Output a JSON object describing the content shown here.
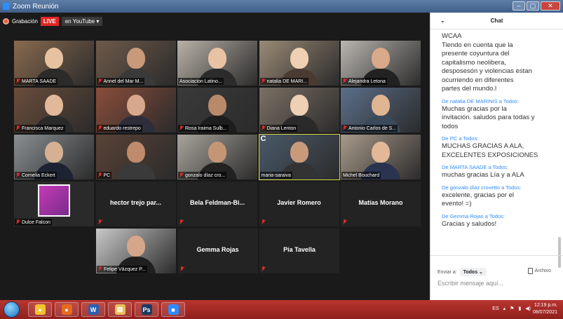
{
  "window": {
    "title": "Zoom Reunión"
  },
  "toolbar": {
    "recording_label": "Grabación",
    "live_label": "LIVE",
    "stream_target": "en YouTube"
  },
  "participants": [
    {
      "name": "MARTA SAADE",
      "muted": true,
      "video": true
    },
    {
      "name": "Annel del Mar M...",
      "muted": true,
      "video": true
    },
    {
      "name": "Asociacion Latino...",
      "muted": false,
      "video": true
    },
    {
      "name": "natalia DE MARI...",
      "muted": true,
      "video": true
    },
    {
      "name": "Alejandra Letona",
      "muted": true,
      "video": true
    },
    {
      "name": "Francisca Marquez",
      "muted": true,
      "video": true
    },
    {
      "name": "eduardo restrepo",
      "muted": true,
      "video": true
    },
    {
      "name": "Rosa Iraima Sulb...",
      "muted": true,
      "video": true
    },
    {
      "name": "Diana Lenton",
      "muted": true,
      "video": true
    },
    {
      "name": "Antonio Carlos de S...",
      "muted": true,
      "video": true
    },
    {
      "name": "Cornelia Eckert",
      "muted": true,
      "video": true
    },
    {
      "name": "PC",
      "muted": true,
      "video": true
    },
    {
      "name": "gonzalo díaz cro...",
      "muted": true,
      "video": true
    },
    {
      "name": "maria-saraiva",
      "muted": false,
      "video": true,
      "active_speaker": true,
      "badge": "C"
    },
    {
      "name": "Michel Bouchard",
      "muted": false,
      "video": true
    },
    {
      "name": "Dulce Falcon",
      "muted": true,
      "video": true
    },
    {
      "name": "hector trejo par...",
      "muted": true,
      "video": false
    },
    {
      "name": "Bela Feldman-Bi...",
      "muted": true,
      "video": false
    },
    {
      "name": "Javier Romero",
      "muted": true,
      "video": false
    },
    {
      "name": "Matías Morano",
      "muted": true,
      "video": false
    },
    {
      "name": "Felipe Vázquez P...",
      "muted": true,
      "video": true
    },
    {
      "name": "Gemma Rojas",
      "muted": true,
      "video": false
    },
    {
      "name": "Pia Tavella",
      "muted": true,
      "video": false
    }
  ],
  "chat": {
    "title": "Chat",
    "first_message": [
      "WCAA",
      "Tiendo en cuenta que la",
      "presente coyuntura del",
      "capitalismo neolibera,",
      "desposesón y violencias estan",
      "ocurriendo en diferentes",
      "partes del mundo.l"
    ],
    "to_label": "a Todos:",
    "messages": [
      {
        "from": "natalia DE MARINIS",
        "lines": [
          "Muchas gracias por la",
          "invitación. saludos para todas y",
          "todos"
        ]
      },
      {
        "from": "PC",
        "lines": [
          "MUCHAS GRACIAS A ALA,",
          "EXCELENTES EXPOSICIONES"
        ]
      },
      {
        "from": "MARTA SAADE",
        "lines": [
          "muchas gracias Lía y a ALA"
        ]
      },
      {
        "from": "gonzalo díaz crovetto",
        "lines": [
          "excelente, gracias por el",
          "evento! =)"
        ]
      },
      {
        "from": "Gemma Rojas",
        "lines": [
          "Gracias y saludos!"
        ]
      }
    ],
    "from_prefix": "De",
    "send_to_label": "Enviar a:",
    "send_to_value": "Todos",
    "file_label": "Archivo",
    "input_placeholder": "Escribir mensaje aquí..."
  },
  "taskbar": {
    "apps": [
      "chrome-icon",
      "firefox-icon",
      "word-icon",
      "explorer-icon",
      "photoshop-icon",
      "zoom-icon"
    ],
    "language": "ES",
    "time": "12:19 p.m.",
    "date": "08/07/2021"
  },
  "colors": {
    "accent": "#2d8cff",
    "live": "#e02727",
    "taskbar": "#a92a26",
    "active_speaker": "#d7d84a"
  }
}
